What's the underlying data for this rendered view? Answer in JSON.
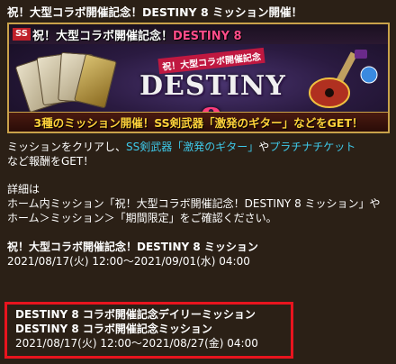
{
  "title": "祝！大型コラボ開催記念！DESTINY 8 ミッション開催！",
  "banner": {
    "badge": "SS",
    "top_prefix": "祝",
    "top_text": "！大型コラボ開催記念！",
    "top_accent": "DESTINY 8",
    "logo_sub": "祝！大型コラボ開催記念",
    "logo_main": "DESTINY",
    "logo_num": "8",
    "bottom_text": "3種のミッション開催！SS剣武器「激発のギター」などをGET！"
  },
  "intro": {
    "text1": "ミッションをクリアし、",
    "link1": "SS剣武器「激発のギター」",
    "text2": "や",
    "link2": "プラチナチケット",
    "text3": "など報酬をGET！"
  },
  "details": {
    "line1": "詳細は",
    "line2": "ホーム内ミッション「祝！大型コラボ開催記念！DESTINY 8 ミッション」や",
    "line3": "ホーム＞ミッション＞「期間限定」をご確認ください。"
  },
  "section1": {
    "heading": "祝！大型コラボ開催記念！DESTINY 8 ミッション",
    "period": "2021/08/17(火) 12:00～2021/09/01(水) 04:00"
  },
  "section2": {
    "line1": "DESTINY 8 コラボ開催記念デイリーミッション",
    "line2": "DESTINY 8 コラボ開催記念ミッション",
    "period": "2021/08/17(火) 12:00～2021/08/27(金) 04:00"
  },
  "colors": {
    "background": "#2b2016",
    "link": "#3ec8e8",
    "highlight_border": "#e8141e",
    "banner_bottom_text": "#ffd23a"
  }
}
